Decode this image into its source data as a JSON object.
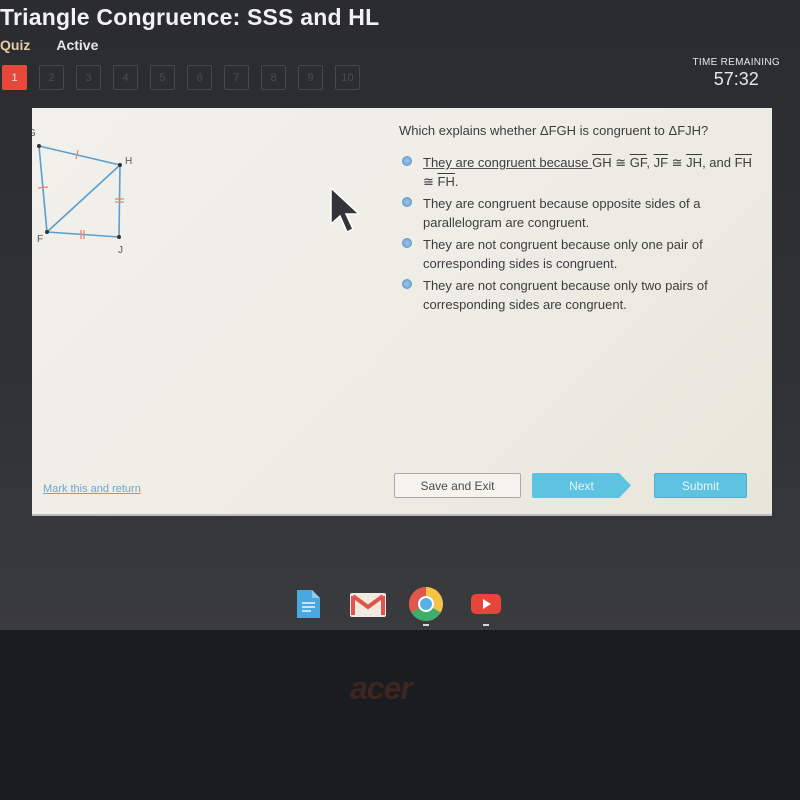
{
  "header": {
    "title": "Triangle Congruence: SSS and HL",
    "type_label": "Quiz",
    "status_label": "Active"
  },
  "question_nav": {
    "current": 1,
    "items": [
      "1",
      "2",
      "3",
      "4",
      "5",
      "6",
      "7",
      "8",
      "9",
      "10"
    ]
  },
  "timer": {
    "label": "TIME REMAINING",
    "value": "57:32"
  },
  "figure": {
    "vertices": [
      "G",
      "H",
      "F",
      "J"
    ],
    "segments": [
      "GH",
      "GF",
      "HJ",
      "FJ",
      "FH"
    ],
    "tick_marks": {
      "GH": 1,
      "GF": 1,
      "HJ": 2,
      "FJ": 2
    },
    "line_color": "#5a9fcf",
    "tick_color": "#e8806a"
  },
  "question": {
    "prompt": "Which explains whether ΔFGH is congruent to ΔFJH?",
    "options": [
      {
        "parts": [
          "They are congruent because ",
          "GH",
          " ≅ ",
          "GF",
          ", ",
          "JF",
          " ≅ ",
          "JH",
          ", and ",
          "FH",
          " ≅ ",
          "FH",
          "."
        ]
      },
      {
        "text": "They are congruent because opposite sides of a parallelogram are congruent."
      },
      {
        "text": "They are not congruent because only one pair of corresponding sides is congruent."
      },
      {
        "text": "They are not congruent because only two pairs of corresponding sides are congruent."
      }
    ]
  },
  "footer": {
    "mark_link": "Mark this and return",
    "save_exit": "Save and Exit",
    "next": "Next",
    "submit": "Submit"
  },
  "shelf": {
    "apps": [
      "docs-icon",
      "gmail-icon",
      "chrome-icon",
      "youtube-icon"
    ]
  },
  "bezel": {
    "brand": "acer"
  }
}
